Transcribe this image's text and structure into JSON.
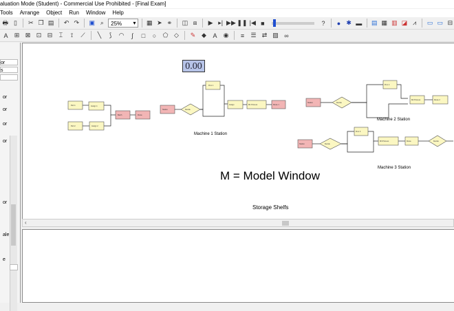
{
  "window": {
    "title": "aluation Mode (Student) - Commercial Use Prohibited - [Final Exam]"
  },
  "menu": [
    "Tools",
    "Arrange",
    "Object",
    "Run",
    "Window",
    "Help"
  ],
  "toolbar": {
    "zoom": "25%"
  },
  "model": {
    "counter": "0.00",
    "labels": {
      "machine1": "Machine 1 Station",
      "machine2": "Machine 2 Station",
      "machine3": "Machine 3 Station",
      "model_window": "M = Model Window",
      "storage": "Storage Shelfs"
    }
  },
  "left_panel": {
    "items": [
      "or",
      "s",
      "or",
      "or",
      "or",
      "or",
      "or",
      "ale",
      "e"
    ]
  }
}
